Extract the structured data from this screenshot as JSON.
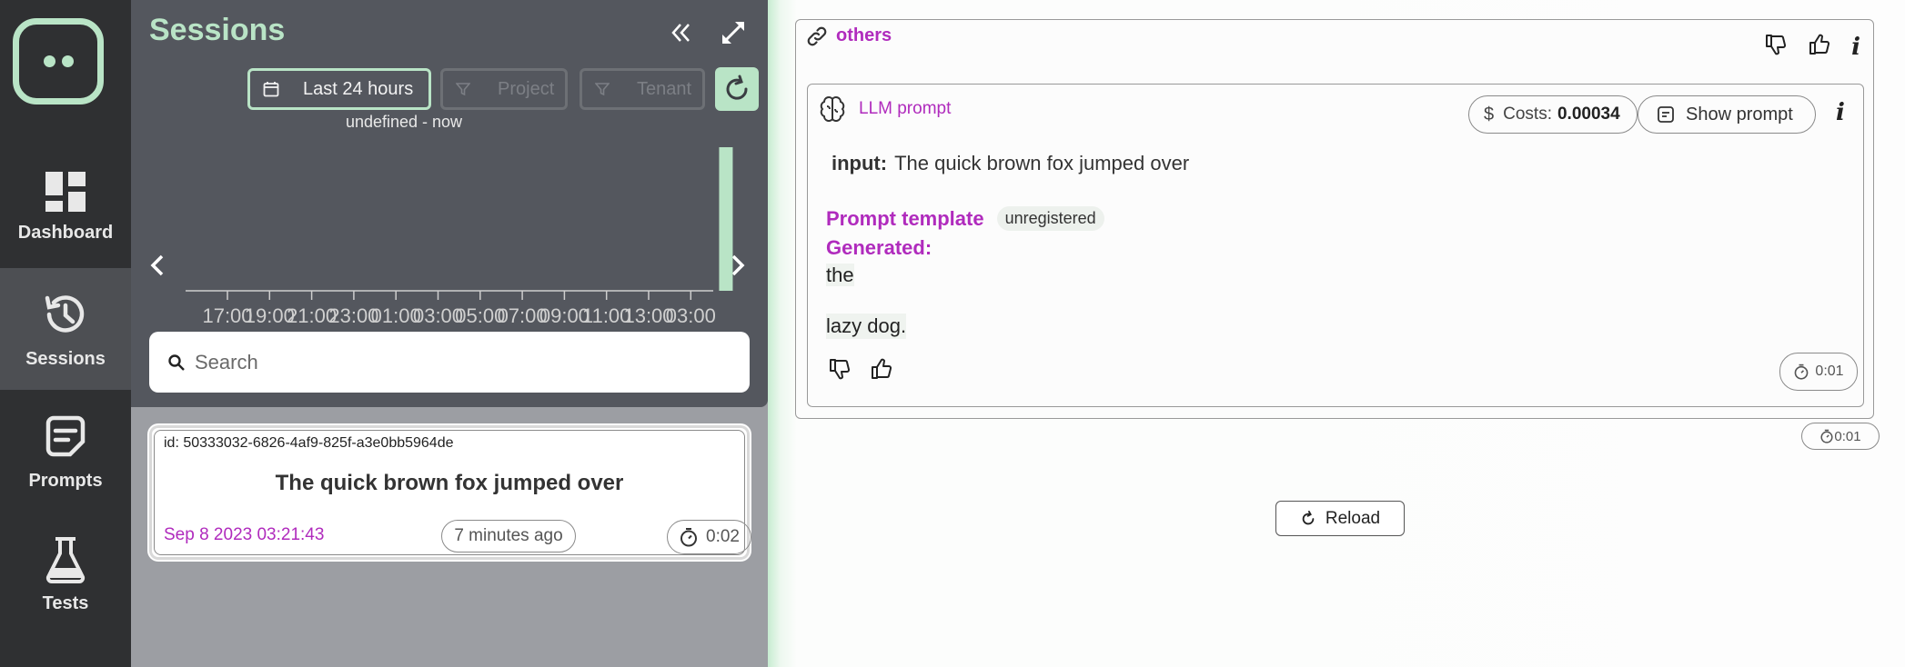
{
  "nav": {
    "items": [
      {
        "label": "Dashboard",
        "icon": "dashboard-icon"
      },
      {
        "label": "Sessions",
        "icon": "history-icon"
      },
      {
        "label": "Prompts",
        "icon": "prompt-icon"
      },
      {
        "label": "Tests",
        "icon": "flask-icon"
      }
    ],
    "active": "Sessions"
  },
  "sessions_panel": {
    "title": "Sessions",
    "date_range_label": "Last 24 hours",
    "date_range_sub": "undefined - now",
    "filters": [
      "Project",
      "Tenant"
    ],
    "search_placeholder": "Search"
  },
  "chart_data": {
    "type": "bar",
    "x_tick_labels": [
      "17:00",
      "19:00",
      "21:00",
      "23:00",
      "01:00",
      "03:00",
      "05:00",
      "07:00",
      "09:00",
      "11:00",
      "13:00",
      "03:00"
    ],
    "bars": [
      {
        "index": 12,
        "value": 1
      }
    ],
    "ylim": [
      0,
      1
    ],
    "grid": false
  },
  "session_card": {
    "id_text": "id: 50333032-6826-4af9-825f-a3e0bb5964de",
    "title": "The quick brown fox jumped over",
    "date": "Sep 8 2023 03:21:43",
    "ago": "7 minutes ago",
    "duration": "0:02"
  },
  "detail": {
    "link_label": "others",
    "llm_label": "LLM prompt",
    "costs_label": "Costs:",
    "costs_value": "0.00034",
    "show_prompt_label": "Show prompt",
    "input_label": "input:",
    "input_value": "The quick brown fox jumped over",
    "prompt_template_label": "Prompt template",
    "prompt_template_tag": "unregistered",
    "generated_label": "Generated:",
    "generated_line1": "the",
    "generated_line2": "lazy dog.",
    "inner_duration": "0:01",
    "outer_duration": "0:01",
    "reload_label": "Reload",
    "info_glyph": "i"
  },
  "colors": {
    "accent_green": "#b9e4c6",
    "accent_purple": "#b02bbd",
    "nav_bg": "#2f3032",
    "panel_bg": "#54575e"
  }
}
